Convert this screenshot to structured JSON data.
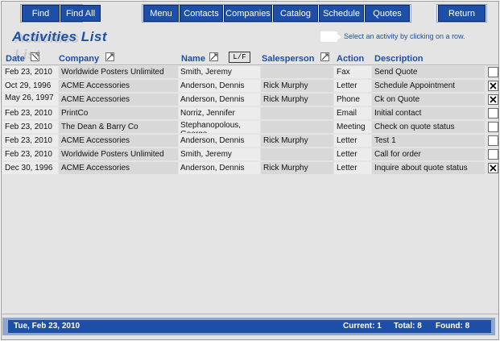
{
  "toolbar": {
    "find_label": "Find",
    "find_all_label": "Find All",
    "menu_label": "Menu",
    "contacts_label": "Contacts",
    "companies_label": "Companies",
    "catalog_label": "Catalog",
    "schedule_label": "Schedule",
    "quotes_label": "Quotes",
    "return_label": "Return"
  },
  "page": {
    "title": "Activities List",
    "hint": "Select an activity by clicking on a row."
  },
  "columns": {
    "date": "Date",
    "company": "Company",
    "name": "Name",
    "lf_button": "L/F",
    "salesperson": "Salesperson",
    "action": "Action",
    "description": "Description"
  },
  "rows": [
    {
      "date": "Feb 23, 2010",
      "company": "Worldwide Posters Unlimited",
      "name": "Smith, Jeremy",
      "salesperson": "",
      "action": "Fax",
      "description": "Send Quote",
      "checked": false
    },
    {
      "date": "Oct 29, 1996",
      "company": "ACME Accessories",
      "name": "Anderson, Dennis",
      "salesperson": "Rick Murphy",
      "action": "Letter",
      "description": "Schedule Appointment",
      "checked": true
    },
    {
      "date": "May 26, 1997",
      "company": "ACME Accessories",
      "name": "Anderson, Dennis",
      "salesperson": "Rick Murphy",
      "action": "Phone",
      "description": "Ck on Quote",
      "checked": true
    },
    {
      "date": "Feb 23, 2010",
      "company": "PrintCo",
      "name": "Norriz, Jennifer",
      "salesperson": "",
      "action": "Email",
      "description": "Initial contact",
      "checked": false
    },
    {
      "date": "Feb 23, 2010",
      "company": "The Dean & Barry Co",
      "name": "Stephanopolous, George",
      "salesperson": "",
      "action": "Meeting",
      "description": "Check on quote status",
      "checked": false
    },
    {
      "date": "Feb 23, 2010",
      "company": "ACME Accessories",
      "name": "Anderson, Dennis",
      "salesperson": "Rick Murphy",
      "action": "Letter",
      "description": "Test 1",
      "checked": false
    },
    {
      "date": "Feb 23, 2010",
      "company": "Worldwide Posters Unlimited",
      "name": "Smith, Jeremy",
      "salesperson": "",
      "action": "Letter",
      "description": "Call for order",
      "checked": false
    },
    {
      "date": "Dec 30, 1996",
      "company": "ACME Accessories",
      "name": "Anderson, Dennis",
      "salesperson": "Rick Murphy",
      "action": "Letter",
      "description": "Inquire about quote status",
      "checked": true
    }
  ],
  "footer": {
    "date": "Tue, Feb 23, 2010",
    "current": "Current: 1",
    "total": "Total: 8",
    "found": "Found: 8"
  },
  "colors": {
    "accent": "#1d4fa6",
    "background": "#e4e4e4"
  }
}
